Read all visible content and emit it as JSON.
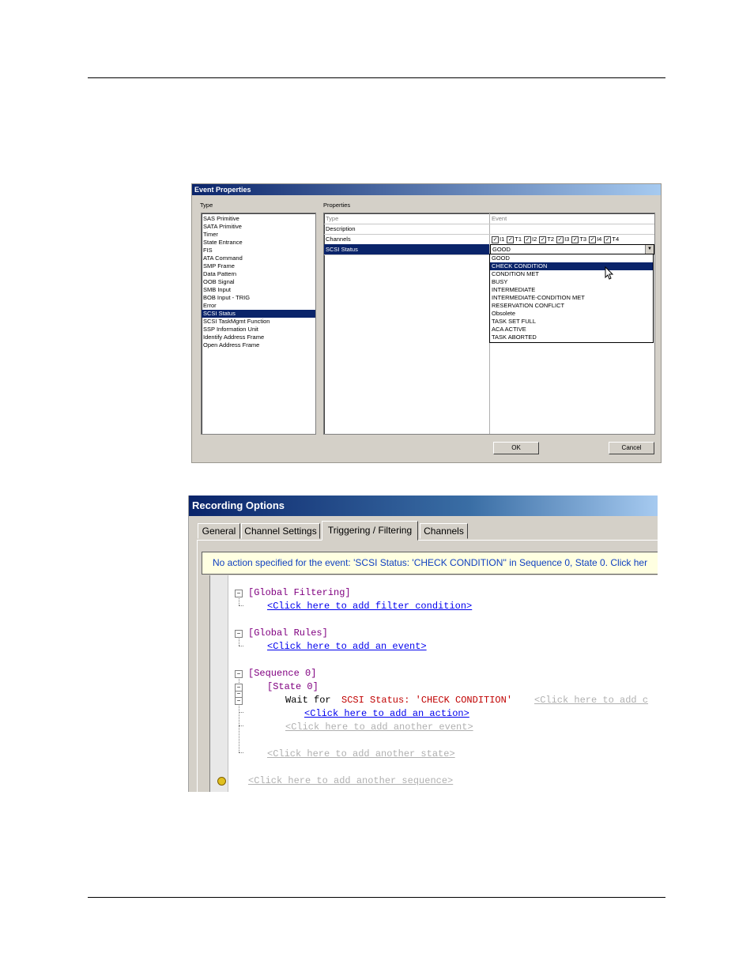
{
  "event_properties": {
    "title": "Event Properties",
    "type_label": "Type",
    "properties_label": "Properties",
    "type_items": [
      "SAS Primitive",
      "SATA Primitive",
      "Timer",
      "State Entrance",
      "FIS",
      "ATA Command",
      "SMP Frame",
      "Data Pattern",
      "OOB Signal",
      "SMB Input",
      "BOB Input - TRIG",
      "Error",
      "SCSI Status",
      "SCSI TaskMgmt Function",
      "SSP Information Unit",
      "Identify Address Frame",
      "Open Address Frame"
    ],
    "selected_type": "SCSI Status",
    "rows": {
      "type_k": "Type",
      "type_v": "Event",
      "desc_k": "Description",
      "channels_k": "Channels",
      "status_k": "SCSI Status",
      "status_v": "GOOD"
    },
    "channels": [
      "I1",
      "T1",
      "I2",
      "T2",
      "I3",
      "T3",
      "I4",
      "T4"
    ],
    "dropdown_options": [
      "GOOD",
      "CHECK CONDITION",
      "CONDITION MET",
      "BUSY",
      "INTERMEDIATE",
      "INTERMEDIATE-CONDITION MET",
      "RESERVATION CONFLICT",
      "Obsolete",
      "TASK SET FULL",
      "ACA ACTIVE",
      "TASK ABORTED"
    ],
    "dropdown_selected": "CHECK CONDITION",
    "ok_label": "OK",
    "cancel_label": "Cancel"
  },
  "recording_options": {
    "title": "Recording Options",
    "tabs": [
      "General",
      "Channel Settings",
      "Triggering / Filtering",
      "Channels"
    ],
    "active_tab": "Triggering / Filtering",
    "banner": "No action specified for the event: 'SCSI Status: 'CHECK CONDITION'' in Sequence 0, State 0.  Click her",
    "tree": {
      "global_filtering": "[Global Filtering]",
      "add_filter": "<Click here to add filter condition>",
      "global_rules": "[Global Rules]",
      "add_event": "<Click here to add an event>",
      "sequence": "[Sequence 0]",
      "state": "[State 0]",
      "wait_for": "Wait for",
      "event_name": "SCSI Status: 'CHECK CONDITION'",
      "add_c": "<Click here to add c",
      "add_action": "<Click here to add an action>",
      "add_another_event": "<Click here to add another event>",
      "add_another_state": "<Click here to add another state>",
      "add_another_sequence": "<Click here to add another sequence>"
    }
  },
  "colors": {
    "title_bar": "#0a246a",
    "selection": "#0a246a",
    "link": "#0000ee",
    "keyword": "#800080",
    "event": "#c00000"
  }
}
